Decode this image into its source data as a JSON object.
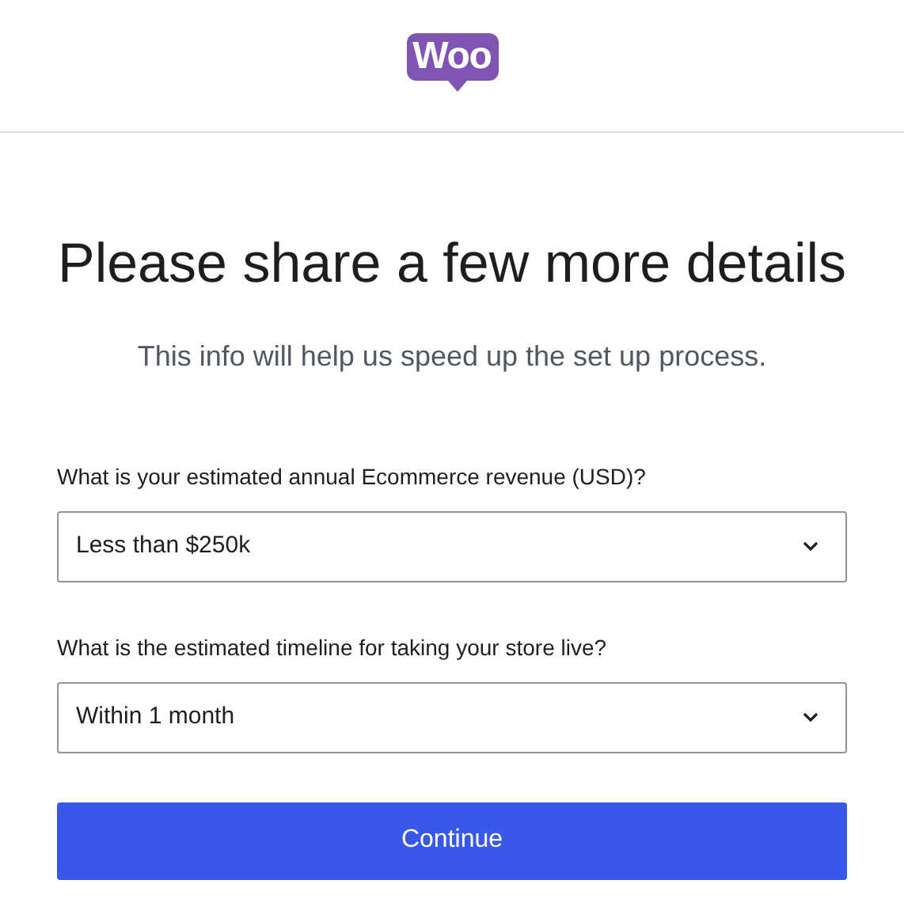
{
  "header": {
    "logo": "Woo"
  },
  "title": "Please share a few more details",
  "subtitle": "This info will help us speed up the set up process.",
  "fields": [
    {
      "label": "What is your estimated annual Ecommerce revenue (USD)?",
      "value": "Less than $250k"
    },
    {
      "label": "What is the estimated timeline for taking your store live?",
      "value": "Within 1 month"
    }
  ],
  "button": "Continue"
}
